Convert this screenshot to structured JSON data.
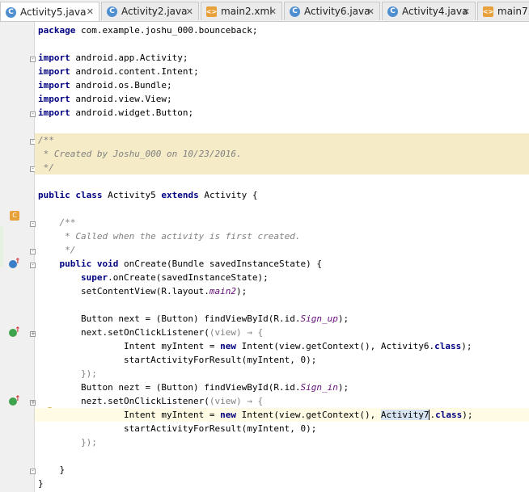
{
  "tabs": [
    {
      "label": "Activity5.java",
      "kind": "class",
      "active": true
    },
    {
      "label": "Activity2.java",
      "kind": "class",
      "active": false
    },
    {
      "label": "main2.xml",
      "kind": "xml",
      "active": false
    },
    {
      "label": "Activity6.java",
      "kind": "class",
      "active": false
    },
    {
      "label": "Activity4.java",
      "kind": "class",
      "active": false
    },
    {
      "label": "main7.",
      "kind": "xml",
      "active": false
    }
  ],
  "code": [
    [
      [
        "kw",
        "package"
      ],
      [
        "t",
        " com.example.joshu_000.bounceback;"
      ]
    ],
    [],
    [
      [
        "kw",
        "import"
      ],
      [
        "t",
        " android.app.Activity;"
      ]
    ],
    [
      [
        "kw",
        "import"
      ],
      [
        "t",
        " android.content.Intent;"
      ]
    ],
    [
      [
        "kw",
        "import"
      ],
      [
        "t",
        " android.os.Bundle;"
      ]
    ],
    [
      [
        "kw",
        "import"
      ],
      [
        "t",
        " android.view.View;"
      ]
    ],
    [
      [
        "kw",
        "import"
      ],
      [
        "t",
        " android.widget.Button;"
      ]
    ],
    [],
    [
      [
        "cm",
        "/**"
      ]
    ],
    [
      [
        "cm",
        " * Created by Joshu_000 on 10/23/2016."
      ]
    ],
    [
      [
        "cm",
        " */"
      ]
    ],
    [],
    [
      [
        "kw",
        "public class"
      ],
      [
        "t",
        " Activity5 "
      ],
      [
        "kw",
        "extends"
      ],
      [
        "t",
        " Activity {"
      ]
    ],
    [],
    [
      [
        "cm",
        "    /**"
      ]
    ],
    [
      [
        "cm",
        "     * Called when the activity is first created."
      ]
    ],
    [
      [
        "cm",
        "     */"
      ]
    ],
    [
      [
        "kw",
        "    public void"
      ],
      [
        "t",
        " onCreate(Bundle savedInstanceState) {"
      ]
    ],
    [
      [
        "kw",
        "        super"
      ],
      [
        "t",
        ".onCreate(savedInstanceState);"
      ]
    ],
    [
      [
        "t",
        "        setContentView(R.layout."
      ],
      [
        "fld",
        "main2"
      ],
      [
        "t",
        ");"
      ]
    ],
    [],
    [
      [
        "t",
        "        Button next = (Button) findViewById(R.id."
      ],
      [
        "fld",
        "Sign_up"
      ],
      [
        "t",
        ");"
      ]
    ],
    [
      [
        "t",
        "        next.setOnClickListener("
      ],
      [
        "lbd",
        "(view) → {"
      ]
    ],
    [
      [
        "t",
        "                Intent myIntent = "
      ],
      [
        "kw",
        "new"
      ],
      [
        "t",
        " Intent(view.getContext(), Activity6."
      ],
      [
        "kw",
        "class"
      ],
      [
        "t",
        ");"
      ]
    ],
    [
      [
        "t",
        "                startActivityForResult(myIntent, 0);"
      ]
    ],
    [
      [
        "lbd",
        "        });"
      ]
    ],
    [
      [
        "t",
        "        Button nezt = (Button) findViewById(R.id."
      ],
      [
        "fld",
        "Sign_in"
      ],
      [
        "t",
        ");"
      ]
    ],
    [
      [
        "t",
        "        nezt.setOnClickListener("
      ],
      [
        "lbd",
        "(view) → {"
      ]
    ],
    [
      [
        "t",
        "                Intent myIntent = "
      ],
      [
        "kw",
        "new"
      ],
      [
        "t",
        " Intent(view.getContext(), "
      ],
      [
        "sel",
        "Activity7"
      ],
      [
        "caret",
        ""
      ],
      [
        "t",
        "."
      ],
      [
        "kw",
        "class"
      ],
      [
        "t",
        ");"
      ]
    ],
    [
      [
        "t",
        "                startActivityForResult(myIntent, 0);"
      ]
    ],
    [
      [
        "lbd",
        "        });"
      ]
    ],
    [],
    [
      [
        "t",
        "    }"
      ]
    ],
    [
      [
        "t",
        "}"
      ]
    ]
  ]
}
